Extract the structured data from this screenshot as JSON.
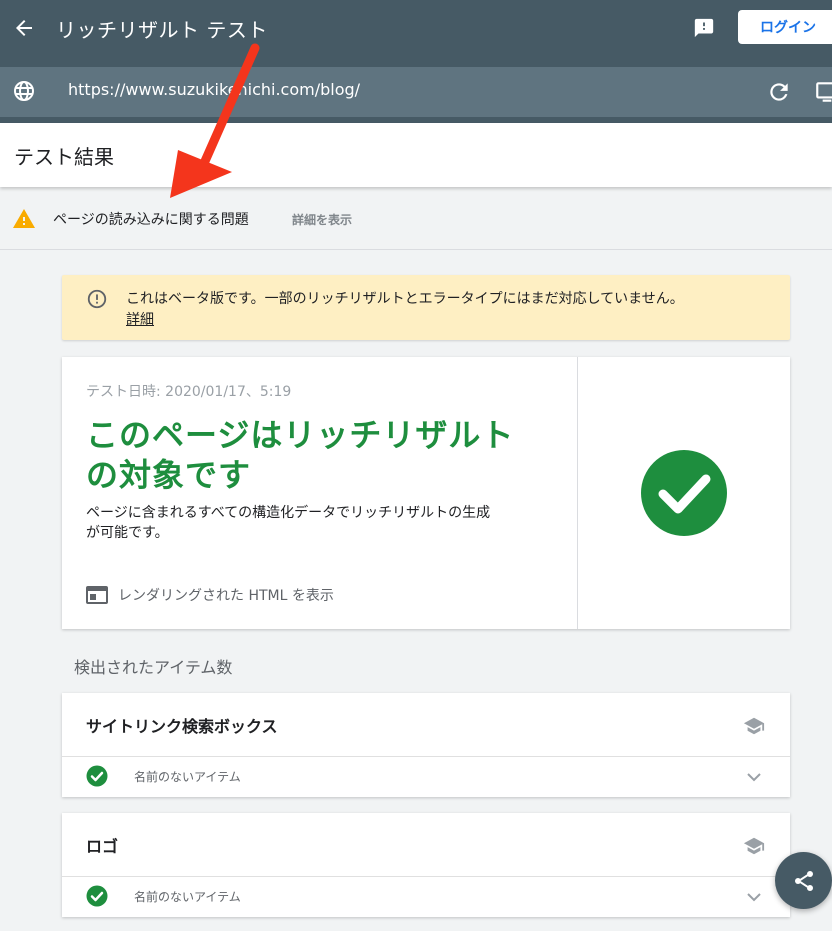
{
  "topbar": {
    "title": "リッチリザルト テスト",
    "login_label": "ログイン"
  },
  "urlbar": {
    "url": "https://www.suzukikenichi.com/blog/"
  },
  "results": {
    "title": "テスト結果"
  },
  "issue": {
    "text": "ページの読み込みに関する問題",
    "link": "詳細を表示"
  },
  "beta": {
    "text": "これはベータ版です。一部のリッチリザルトとエラータイプにはまだ対応していません。",
    "link": "詳細"
  },
  "result_card": {
    "date": "テスト日時: 2020/01/17、5:19",
    "headline_line1": "このページはリッチリザルト",
    "headline_line2": "の対象です",
    "desc_line1": "ページに含まれるすべての構造化データでリッチリザルトの生成",
    "desc_line2": "が可能です。",
    "html_label": "レンダリングされた HTML を表示"
  },
  "items": {
    "heading": "検出されたアイテム数",
    "list": [
      {
        "title": "サイトリンク検索ボックス",
        "sub": "名前のないアイテム"
      },
      {
        "title": "ロゴ",
        "sub": "名前のないアイテム"
      }
    ]
  },
  "colors": {
    "appbar": "#465a65",
    "success": "#1e8e3e",
    "warning": "#f9ab00",
    "beta_bg": "#feefc3",
    "annotation": "#f4351c"
  }
}
